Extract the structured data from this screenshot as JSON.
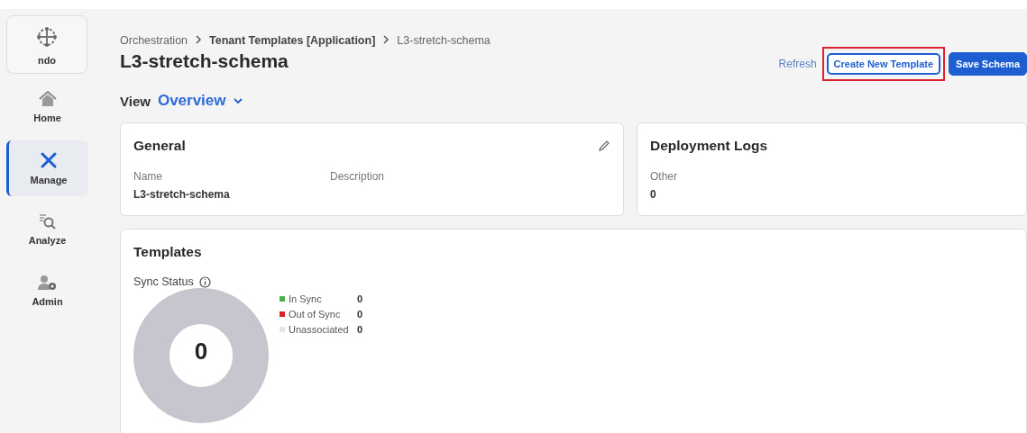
{
  "sidebar": {
    "brand": "ndo",
    "items": [
      {
        "label": "Home",
        "selected": false
      },
      {
        "label": "Manage",
        "selected": true
      },
      {
        "label": "Analyze",
        "selected": false
      },
      {
        "label": "Admin",
        "selected": false
      }
    ]
  },
  "breadcrumb": [
    {
      "label": "Orchestration",
      "bold": false
    },
    {
      "label": "Tenant Templates [Application]",
      "bold": true
    },
    {
      "label": "L3-stretch-schema",
      "bold": false
    }
  ],
  "title": "L3-stretch-schema",
  "actions": [
    {
      "label": "Refresh",
      "kind": "link",
      "highlighted": false
    },
    {
      "label": "Create New Template",
      "kind": "outline",
      "highlighted": true
    },
    {
      "label": "Save Schema",
      "kind": "primary",
      "highlighted": false
    }
  ],
  "view": {
    "label": "View",
    "value": "Overview"
  },
  "general": {
    "title": "General",
    "fields": [
      {
        "label": "Name",
        "value": "L3-stretch-schema"
      },
      {
        "label": "Description"
      }
    ]
  },
  "deployment_logs": {
    "title": "Deployment Logs",
    "fields": [
      {
        "label": "Other",
        "value": "0"
      }
    ]
  },
  "templates": {
    "title": "Templates",
    "sync_label": "Sync Status",
    "total": "0",
    "legend": [
      {
        "label": "In Sync",
        "value": "0",
        "color": "#4caf50"
      },
      {
        "label": "Out of Sync",
        "value": "0",
        "color": "#e02020"
      },
      {
        "label": "Unassociated",
        "value": "0",
        "color": "#e6e6e9"
      }
    ]
  }
}
